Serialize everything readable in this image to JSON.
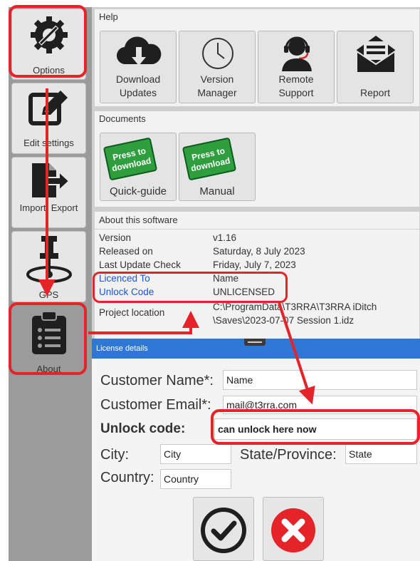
{
  "sidebar": {
    "items": [
      {
        "label": "Options",
        "icon": "gear-wrench-icon"
      },
      {
        "label": "Edit settings",
        "icon": "edit-icon"
      },
      {
        "label": "Import/ Export",
        "icon": "import-export-icon"
      },
      {
        "label": "GPS",
        "icon": "gps-icon"
      },
      {
        "label": "About",
        "icon": "clipboard-list-icon"
      }
    ]
  },
  "help": {
    "title": "Help",
    "tiles": [
      {
        "line1": "Download",
        "line2": "Updates",
        "icon": "cloud-download-icon"
      },
      {
        "line1": "Version",
        "line2": "Manager",
        "icon": "clock-icon"
      },
      {
        "line1": "Remote",
        "line2": "Support",
        "icon": "headset-icon"
      },
      {
        "line1": "",
        "line2": "Report",
        "icon": "envelope-icon"
      }
    ]
  },
  "documents": {
    "title": "Documents",
    "badge_line1": "Press to",
    "badge_line2": "download",
    "tiles": [
      {
        "label": "Quick-guide"
      },
      {
        "label": "Manual"
      }
    ]
  },
  "about": {
    "title": "About this software",
    "version_label": "Version",
    "version_value": "v1.16",
    "released_label": "Released on",
    "released_value": "Saturday, 8 July 2023",
    "lastcheck_label": "Last Update Check",
    "lastcheck_value": "Friday, July 7, 2023",
    "licenced_label": "Licenced To",
    "licenced_value": "Name",
    "unlock_label": "Unlock Code",
    "unlock_value": "UNLICENSED",
    "project_label": "Project location",
    "project_line1": "C:\\ProgramData\\T3RRA\\T3RRA iDitch",
    "project_line2": "\\Saves\\2023-07-07 Session 1.idz"
  },
  "license": {
    "title": "License details",
    "customer_name_label": "Customer Name*:",
    "customer_name_value": "Name",
    "customer_email_label": "Customer Email*:",
    "customer_email_value": "mail@t3rra.com",
    "unlock_label": "Unlock code:",
    "unlock_value": "can unlock here now",
    "city_label": "City:",
    "city_value": "City",
    "state_label": "State/Province:",
    "state_value": "State",
    "country_label": "Country:",
    "country_value": "Country"
  },
  "colors": {
    "highlight": "#e5242a",
    "titlebar": "#2f77d4",
    "link": "#1a55d8",
    "badge": "#2e9e3e"
  }
}
